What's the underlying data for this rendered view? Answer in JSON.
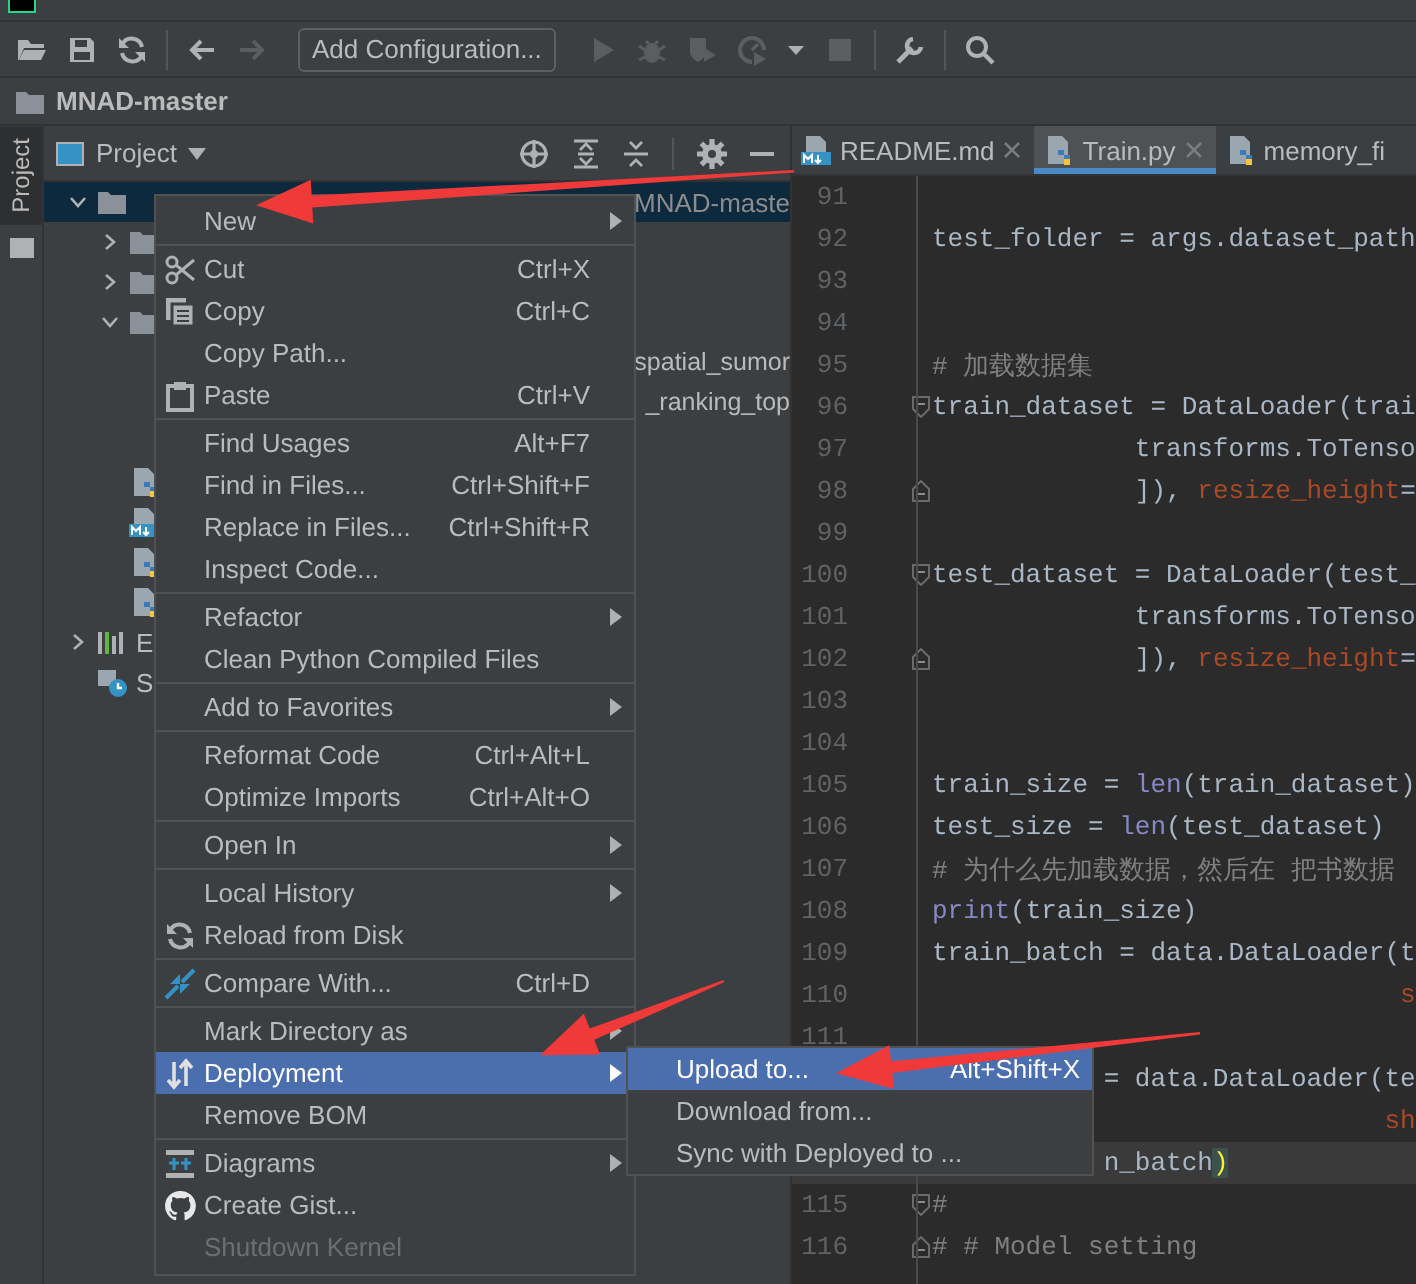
{
  "toolbar": {
    "items": [
      {
        "kind": "open",
        "disabled": false
      },
      {
        "kind": "save",
        "disabled": false
      },
      {
        "kind": "sync",
        "disabled": false
      },
      {
        "kind": "separator"
      },
      {
        "kind": "back",
        "disabled": false
      },
      {
        "kind": "forward",
        "disabled": true
      },
      {
        "kind": "config",
        "label": "Add Configuration..."
      },
      {
        "kind": "run",
        "disabled": true
      },
      {
        "kind": "debug",
        "disabled": true
      },
      {
        "kind": "coverage",
        "disabled": true
      },
      {
        "kind": "profile",
        "disabled": true
      },
      {
        "kind": "dropdown",
        "disabled": false
      },
      {
        "kind": "stop",
        "disabled": true
      },
      {
        "kind": "separator"
      },
      {
        "kind": "wrench",
        "disabled": false
      },
      {
        "kind": "separator"
      },
      {
        "kind": "search",
        "disabled": false
      }
    ]
  },
  "navbar": {
    "project": "MNAD-master"
  },
  "tool_windows": [
    {
      "label": "Project",
      "selected": true
    }
  ],
  "project": {
    "title": "Project",
    "tree": [
      {
        "kind": "folder",
        "path": "MNAD-maste",
        "expanded": true,
        "selected": true,
        "children": [
          {
            "kind": "folder",
            "expanded": false,
            "selected": false
          },
          {
            "kind": "folder",
            "expanded": false,
            "selected": false
          },
          {
            "kind": "folder",
            "expanded": true,
            "selected": false,
            "children": [
              {
                "kind": "fragment",
                "label": "spatial_sumor",
                "selected": false
              },
              {
                "kind": "fragment",
                "label": "_ranking_top",
                "selected": false
              }
            ]
          },
          {
            "kind": "python",
            "selected": false
          },
          {
            "kind": "markdown",
            "selected": false
          },
          {
            "kind": "python",
            "selected": false
          },
          {
            "kind": "python",
            "selected": false
          }
        ]
      },
      {
        "kind": "library",
        "label": "E",
        "expanded": false,
        "selected": false
      },
      {
        "kind": "scratch",
        "label": "S",
        "selected": false
      }
    ]
  },
  "editor": {
    "tabs": [
      {
        "label": "README.md",
        "kind": "markdown",
        "selected": false,
        "closable": true
      },
      {
        "label": "Train.py",
        "kind": "python",
        "selected": true,
        "closable": true
      },
      {
        "label": "memory_fi",
        "kind": "python",
        "selected": false,
        "closable": false
      }
    ],
    "lines": [
      {
        "number": "91",
        "kind": "plain",
        "current": false
      },
      {
        "number": "92",
        "kind": "plain",
        "current": false,
        "tokens": [
          {
            "text": "test_folder = args.dataset_path",
            "kind": "plain"
          }
        ]
      },
      {
        "number": "93",
        "kind": "plain",
        "current": false
      },
      {
        "number": "94",
        "kind": "plain",
        "current": false
      },
      {
        "number": "95",
        "kind": "plain",
        "current": false,
        "tokens": [
          {
            "text": "# 加载数据集",
            "kind": "comment"
          }
        ]
      },
      {
        "number": "96",
        "kind": "fold-start",
        "current": false,
        "tokens": [
          {
            "text": "train_dataset = DataLoader(trai",
            "kind": "plain"
          }
        ]
      },
      {
        "number": "97",
        "kind": "plain",
        "current": false,
        "tokens": [
          {
            "text": "             transforms.ToTenso",
            "kind": "plain"
          }
        ]
      },
      {
        "number": "98",
        "kind": "fold-end",
        "current": false,
        "tokens": [
          {
            "text": "             ]), ",
            "kind": "plain"
          },
          {
            "text": "resize_height",
            "kind": "param"
          },
          {
            "text": "=",
            "kind": "plain"
          }
        ]
      },
      {
        "number": "99",
        "kind": "plain",
        "current": false
      },
      {
        "number": "100",
        "kind": "fold-start",
        "current": false,
        "tokens": [
          {
            "text": "test_dataset = DataLoader(test_",
            "kind": "plain"
          }
        ]
      },
      {
        "number": "101",
        "kind": "plain",
        "current": false,
        "tokens": [
          {
            "text": "             transforms.ToTenso",
            "kind": "plain"
          }
        ]
      },
      {
        "number": "102",
        "kind": "fold-end",
        "current": false,
        "tokens": [
          {
            "text": "             ]), ",
            "kind": "plain"
          },
          {
            "text": "resize_height",
            "kind": "param"
          },
          {
            "text": "=",
            "kind": "plain"
          }
        ]
      },
      {
        "number": "103",
        "kind": "plain",
        "current": false
      },
      {
        "number": "104",
        "kind": "plain",
        "current": false
      },
      {
        "number": "105",
        "kind": "plain",
        "current": false,
        "tokens": [
          {
            "text": "train_size = ",
            "kind": "plain"
          },
          {
            "text": "len",
            "kind": "builtin"
          },
          {
            "text": "(train_dataset)",
            "kind": "plain"
          }
        ]
      },
      {
        "number": "106",
        "kind": "plain",
        "current": false,
        "tokens": [
          {
            "text": "test_size = ",
            "kind": "plain"
          },
          {
            "text": "len",
            "kind": "builtin"
          },
          {
            "text": "(test_dataset)",
            "kind": "plain"
          }
        ]
      },
      {
        "number": "107",
        "kind": "plain",
        "current": false,
        "tokens": [
          {
            "text": "# 为什么先加载数据，然后在 把书数据",
            "kind": "comment"
          }
        ]
      },
      {
        "number": "108",
        "kind": "plain",
        "current": false,
        "tokens": [
          {
            "text": "print",
            "kind": "builtin"
          },
          {
            "text": "(train_size)",
            "kind": "plain"
          }
        ]
      },
      {
        "number": "109",
        "kind": "plain",
        "current": false,
        "tokens": [
          {
            "text": "train_batch = data.DataLoader(t",
            "kind": "plain"
          }
        ]
      },
      {
        "number": "110",
        "kind": "plain",
        "current": false,
        "tokens": [
          {
            "text": "                              s",
            "kind": "param"
          }
        ]
      },
      {
        "number": "111",
        "kind": "plain",
        "current": false
      },
      {
        "kind": "plain",
        "current": false,
        "tokens": [
          {
            "text": "           = data.DataLoader(te",
            "kind": "plain"
          }
        ]
      },
      {
        "kind": "plain",
        "current": false,
        "tokens": [
          {
            "text": "                             sh",
            "kind": "param"
          }
        ]
      },
      {
        "kind": "plain",
        "current": true,
        "tokens": [
          {
            "text": "           n_batch",
            "kind": "plain"
          },
          {
            "text": ")",
            "kind": "bracket"
          }
        ]
      },
      {
        "number": "115",
        "kind": "fold-start",
        "current": false,
        "tokens": [
          {
            "text": "#",
            "kind": "comment"
          }
        ]
      },
      {
        "number": "116",
        "kind": "fold-end",
        "current": false,
        "tokens": [
          {
            "text": "# # Model setting",
            "kind": "comment"
          }
        ]
      }
    ]
  },
  "context_menu": {
    "groups": [
      [
        {
          "label": "New",
          "submenu": true,
          "selected": false,
          "disabled": false
        }
      ],
      [
        {
          "label": "Cut",
          "shortcut": "Ctrl+X",
          "submenu": false,
          "selected": false,
          "disabled": false
        },
        {
          "label": "Copy",
          "shortcut": "Ctrl+C",
          "submenu": false,
          "selected": false,
          "disabled": false
        },
        {
          "label": "Copy Path...",
          "submenu": false,
          "selected": false,
          "disabled": false
        },
        {
          "label": "Paste",
          "shortcut": "Ctrl+V",
          "submenu": false,
          "selected": false,
          "disabled": false
        }
      ],
      [
        {
          "label": "Find Usages",
          "shortcut": "Alt+F7",
          "submenu": false,
          "selected": false,
          "disabled": false
        },
        {
          "label": "Find in Files...",
          "shortcut": "Ctrl+Shift+F",
          "submenu": false,
          "selected": false,
          "disabled": false
        },
        {
          "label": "Replace in Files...",
          "shortcut": "Ctrl+Shift+R",
          "submenu": false,
          "selected": false,
          "disabled": false
        },
        {
          "label": "Inspect Code...",
          "submenu": false,
          "selected": false,
          "disabled": false
        }
      ],
      [
        {
          "label": "Refactor",
          "submenu": true,
          "selected": false,
          "disabled": false
        },
        {
          "label": "Clean Python Compiled Files",
          "submenu": false,
          "selected": false,
          "disabled": false
        }
      ],
      [
        {
          "label": "Add to Favorites",
          "submenu": true,
          "selected": false,
          "disabled": false
        }
      ],
      [
        {
          "label": "Reformat Code",
          "shortcut": "Ctrl+Alt+L",
          "submenu": false,
          "selected": false,
          "disabled": false
        },
        {
          "label": "Optimize Imports",
          "shortcut": "Ctrl+Alt+O",
          "submenu": false,
          "selected": false,
          "disabled": false
        }
      ],
      [
        {
          "label": "Open In",
          "submenu": true,
          "selected": false,
          "disabled": false
        }
      ],
      [
        {
          "label": "Local History",
          "submenu": true,
          "selected": false,
          "disabled": false
        },
        {
          "label": "Reload from Disk",
          "submenu": false,
          "selected": false,
          "disabled": false
        }
      ],
      [
        {
          "label": "Compare With...",
          "shortcut": "Ctrl+D",
          "submenu": false,
          "selected": false,
          "disabled": false
        }
      ],
      [
        {
          "label": "Mark Directory as",
          "submenu": true,
          "selected": false,
          "disabled": false
        },
        {
          "label": "Deployment",
          "submenu": true,
          "selected": true,
          "disabled": false
        },
        {
          "label": "Remove BOM",
          "submenu": false,
          "selected": false,
          "disabled": false
        }
      ],
      [
        {
          "label": "Diagrams",
          "submenu": true,
          "selected": false,
          "disabled": false
        },
        {
          "label": "Create Gist...",
          "submenu": false,
          "selected": false,
          "disabled": false
        },
        {
          "label": "Shutdown Kernel",
          "submenu": false,
          "selected": false,
          "disabled": true
        }
      ]
    ]
  },
  "submenu": {
    "items": [
      {
        "label": "Upload to...",
        "shortcut": "Alt+Shift+X",
        "selected": true
      },
      {
        "label": "Download from...",
        "selected": false
      },
      {
        "label": "Sync with Deployed to ...",
        "selected": false
      }
    ]
  }
}
